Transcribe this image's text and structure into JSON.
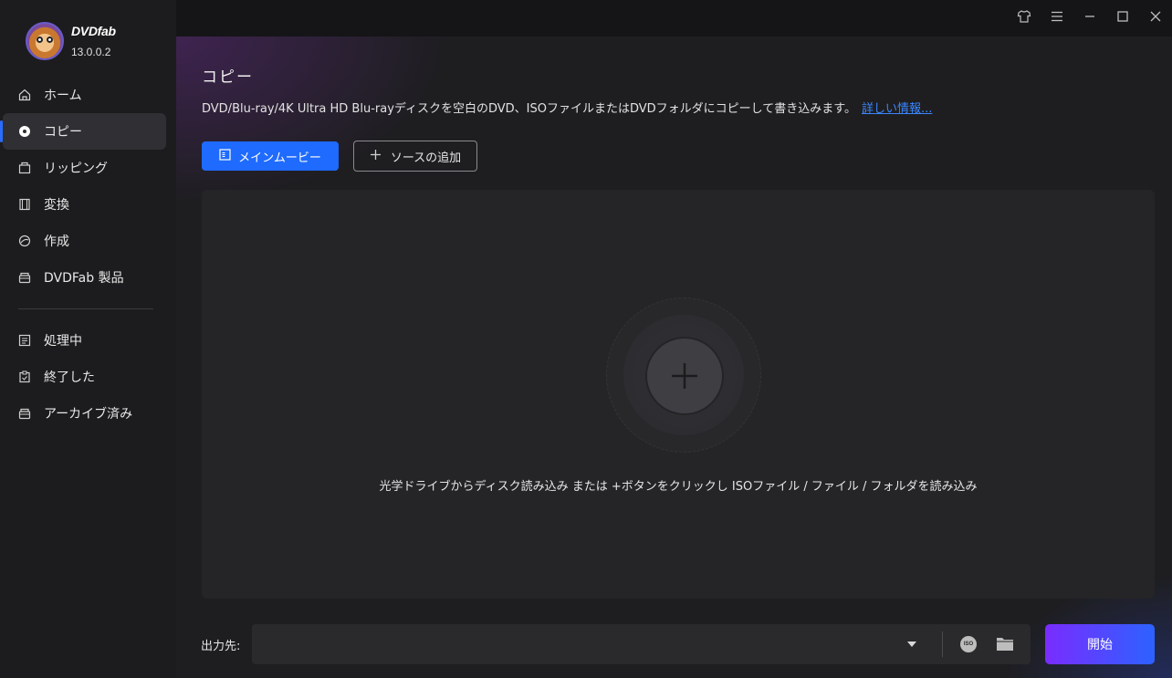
{
  "brand": {
    "name": "DVDfab",
    "version": "13.0.0.2"
  },
  "sidebar": {
    "items": [
      {
        "label": "ホーム",
        "icon": "home-icon"
      },
      {
        "label": "コピー",
        "icon": "disc-icon",
        "active": true
      },
      {
        "label": "リッピング",
        "icon": "rip-icon"
      },
      {
        "label": "変換",
        "icon": "film-icon"
      },
      {
        "label": "作成",
        "icon": "create-icon"
      },
      {
        "label": "DVDFab 製品",
        "icon": "box-icon"
      }
    ],
    "tasks": [
      {
        "label": "処理中",
        "icon": "queue-icon"
      },
      {
        "label": "終了した",
        "icon": "clipboard-icon"
      },
      {
        "label": "アーカイブ済み",
        "icon": "archive-icon"
      }
    ]
  },
  "titlebar": {
    "icons": [
      "shirt-icon",
      "menu-icon",
      "minimize-icon",
      "maximize-icon",
      "close-icon"
    ]
  },
  "main": {
    "title": "コピー",
    "description": "DVD/Blu-ray/4K Ultra HD Blu-rayディスクを空白のDVD、ISOファイルまたはDVDフォルダにコピーして書き込みます。",
    "more_link": "詳しい情報...",
    "mode_button": "メインムービー",
    "add_source_button": "ソースの追加",
    "drop_hint": "光学ドライブからディスク読み込み または +ボタンをクリックし ISOファイル / ファイル / フォルダを読み込み"
  },
  "output": {
    "label": "出力先:",
    "value": "",
    "iso_label": "ISO",
    "start_button": "開始"
  },
  "colors": {
    "accent": "#1f6bff",
    "start_gradient_from": "#7a2cff",
    "start_gradient_to": "#2c62ff"
  }
}
